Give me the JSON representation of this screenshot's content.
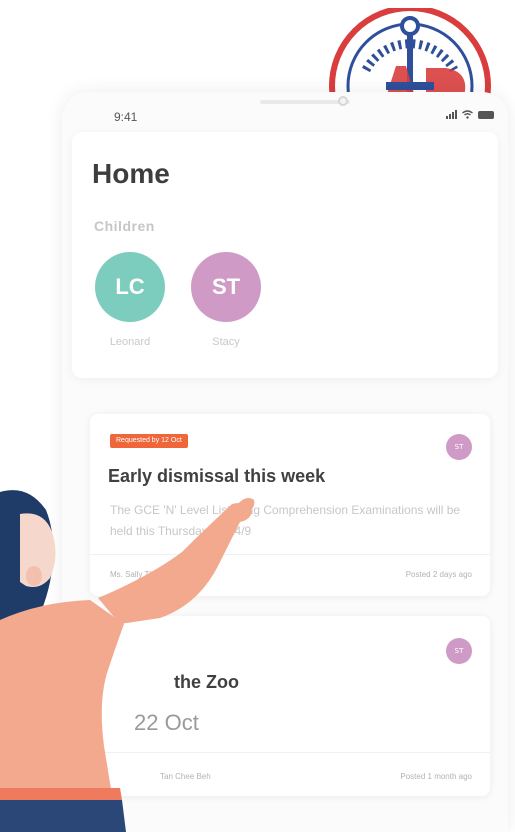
{
  "status_bar": {
    "time": "9:41"
  },
  "header": {
    "title": "Home",
    "section_label": "Children"
  },
  "children": [
    {
      "initials": "LC",
      "name": "Leonard",
      "color": "#7ccdbd"
    },
    {
      "initials": "ST",
      "name": "Stacy",
      "color": "#cf9bc6"
    }
  ],
  "announcements": [
    {
      "tag": "Requested by 12 Oct",
      "tag_color": "#f0663b",
      "avatar": "ST",
      "title": "Early dismissal this week",
      "body": "The GCE 'N' Level Listening Comprehension Examinations will be held this Thursday on 14/9",
      "author": "Ms. Sally Tham",
      "posted": "Posted 2 days ago"
    },
    {
      "avatar": "ST",
      "title": "the Zoo",
      "date": "22 Oct",
      "author": "Tan Chee Beh",
      "posted": "Posted 1 month ago"
    }
  ],
  "colors": {
    "accent_orange": "#f0663b",
    "teal": "#7ccdbd",
    "purple": "#cf9bc6",
    "skin": "#f3a98e",
    "hair": "#1f3c68"
  }
}
